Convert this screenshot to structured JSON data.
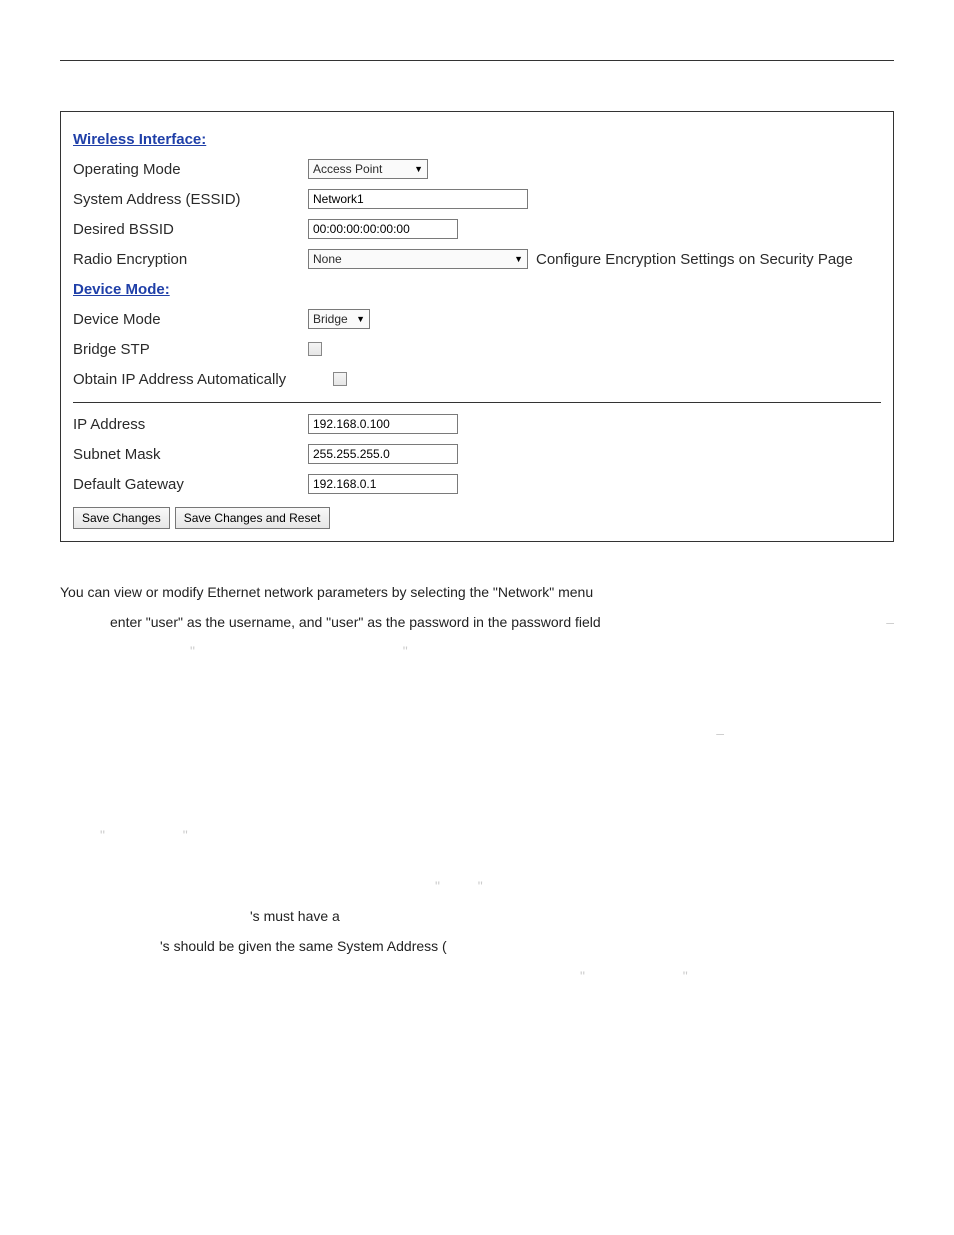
{
  "wireless": {
    "section_title": "Wireless Interface:",
    "operating_mode": {
      "label": "Operating Mode",
      "value": "Access Point"
    },
    "essid": {
      "label": "System Address (ESSID)",
      "value": "Network1"
    },
    "bssid": {
      "label": "Desired BSSID",
      "value": "00:00:00:00:00:00"
    },
    "encryption": {
      "label": "Radio Encryption",
      "value": "None",
      "link": "Configure Encryption Settings on Security Page"
    }
  },
  "device": {
    "section_title": "Device Mode:",
    "mode": {
      "label": "Device Mode",
      "value": "Bridge"
    },
    "stp": {
      "label": "Bridge STP"
    },
    "dhcp": {
      "label": "Obtain IP Address Automatically"
    }
  },
  "ip": {
    "address": {
      "label": "IP Address",
      "value": "192.168.0.100"
    },
    "subnet": {
      "label": "Subnet Mask",
      "value": "255.255.255.0"
    },
    "gateway": {
      "label": "Default Gateway",
      "value": "192.168.0.1"
    }
  },
  "buttons": {
    "save": "Save Changes",
    "save_reset": "Save Changes and Reset"
  },
  "doc": {
    "p1": "You can view or modify Ethernet network parameters by selecting the \"Network\" menu",
    "p2": "enter \"user\" as the username, and \"user\" as the password in the password field",
    "dash1": "–",
    "dash2": "–",
    "q1a": "\"",
    "q1b": "\"",
    "q2a": "\"",
    "q2b": "\"",
    "p3": "'s must have a",
    "p4": "'s should be given the same System Address (",
    "q3a": "\"",
    "q3b": "\""
  }
}
